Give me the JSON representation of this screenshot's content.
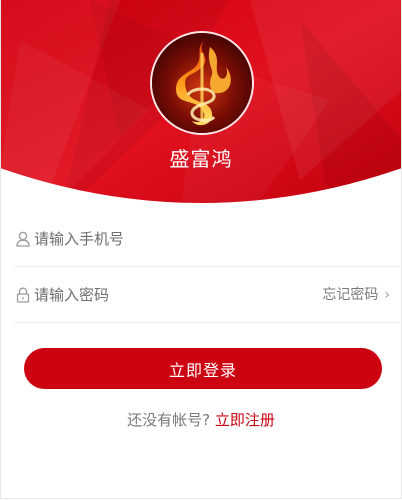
{
  "brand": {
    "name": "盛富鸿",
    "logo_icon": "flame-dollar-logo-icon"
  },
  "colors": {
    "primary": "#cc0412",
    "header_dark": "#b4000b",
    "header_light": "#e8182a"
  },
  "login_form": {
    "phone_placeholder": "请输入手机号",
    "phone_icon": "user-icon",
    "password_placeholder": "请输入密码",
    "password_icon": "lock-icon",
    "forgot_label": "忘记密码",
    "forgot_icon": "chevron-right-icon",
    "submit_label": "立即登录"
  },
  "register_prompt": {
    "text": "还没有帐号?",
    "link_label": "立即注册"
  }
}
